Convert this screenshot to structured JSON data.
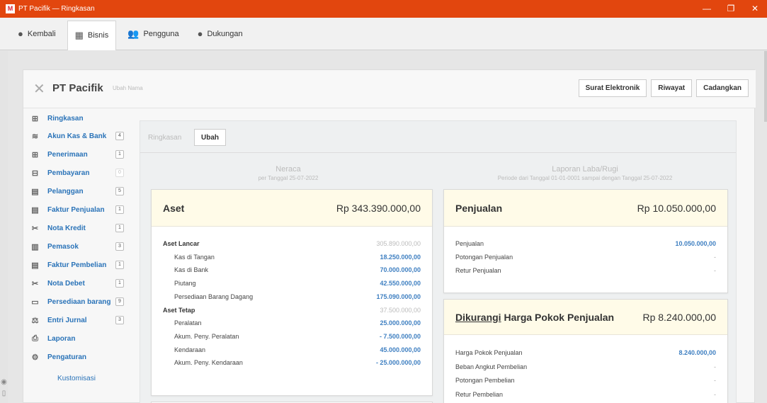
{
  "window": {
    "logo": "M",
    "title": "PT Pacifik — Ringkasan",
    "controls": [
      "—",
      "❐",
      "✕"
    ]
  },
  "topnav": [
    {
      "icon": "back-icon",
      "glyph": "●",
      "label": "Kembali"
    },
    {
      "icon": "building-icon",
      "glyph": "▦",
      "label": "Bisnis"
    },
    {
      "icon": "users-icon",
      "glyph": "👥",
      "label": "Pengguna"
    },
    {
      "icon": "help-icon",
      "glyph": "●",
      "label": "Dukungan"
    }
  ],
  "header": {
    "company": "PT Pacifik",
    "rename": "Ubah Nama",
    "buttons": [
      "Surat Elektronik",
      "Riwayat",
      "Cadangkan"
    ]
  },
  "sidebar": {
    "items": [
      {
        "label": "Ringkasan",
        "icon": "presentation-icon",
        "glyph": "⊞",
        "badge": ""
      },
      {
        "label": "Akun Kas & Bank",
        "icon": "coins-icon",
        "glyph": "≋",
        "badge": "4"
      },
      {
        "label": "Penerimaan",
        "icon": "plus-icon",
        "glyph": "⊞",
        "badge": "1"
      },
      {
        "label": "Pembayaran",
        "icon": "minus-icon",
        "glyph": "⊟",
        "badge": "0"
      },
      {
        "label": "Pelanggan",
        "icon": "customers-icon",
        "glyph": "▤",
        "badge": "5"
      },
      {
        "label": "Faktur Penjualan",
        "icon": "invoice-icon",
        "glyph": "▤",
        "badge": "1"
      },
      {
        "label": "Nota Kredit",
        "icon": "scissors-icon",
        "glyph": "✂",
        "badge": "1"
      },
      {
        "label": "Pemasok",
        "icon": "suppliers-icon",
        "glyph": "▥",
        "badge": "3"
      },
      {
        "label": "Faktur Pembelian",
        "icon": "invoice-icon",
        "glyph": "▤",
        "badge": "1"
      },
      {
        "label": "Nota Debet",
        "icon": "scissors-icon",
        "glyph": "✂",
        "badge": "1"
      },
      {
        "label": "Persediaan barang",
        "icon": "inventory-icon",
        "glyph": "▭",
        "badge": "9"
      },
      {
        "label": "Entri Jurnal",
        "icon": "journal-icon",
        "glyph": "⚖",
        "badge": "3"
      },
      {
        "label": "Laporan",
        "icon": "printer-icon",
        "glyph": "⎙",
        "badge": ""
      },
      {
        "label": "Pengaturan",
        "icon": "gear-icon",
        "glyph": "⚙",
        "badge": ""
      }
    ],
    "customize": "Kustomisasi"
  },
  "tabs": {
    "label": "Ringkasan",
    "button": "Ubah"
  },
  "neraca": {
    "title": "Neraca",
    "subtitle": "per Tanggal 25-07-2022"
  },
  "labarugi": {
    "title": "Laporan Laba/Rugi",
    "subtitle": "Periode dari Tanggal 01-01-0001 sampai dengan Tanggal 25-07-2022"
  },
  "aset": {
    "title": "Aset",
    "total": "Rp 343.390.000,00",
    "rows": [
      {
        "label": "Aset Lancar",
        "value": "305.890.000,00",
        "kind": "group"
      },
      {
        "label": "Kas di Tangan",
        "value": "18.250.000,00",
        "kind": "sub"
      },
      {
        "label": "Kas di Bank",
        "value": "70.000.000,00",
        "kind": "sub"
      },
      {
        "label": "Piutang",
        "value": "42.550.000,00",
        "kind": "sub"
      },
      {
        "label": "Persediaan Barang Dagang",
        "value": "175.090.000,00",
        "kind": "sub"
      },
      {
        "label": "Aset Tetap",
        "value": "37.500.000,00",
        "kind": "group"
      },
      {
        "label": "Peralatan",
        "value": "25.000.000,00",
        "kind": "sub"
      },
      {
        "label": "Akum. Peny. Peralatan",
        "value": "- 7.500.000,00",
        "kind": "sub"
      },
      {
        "label": "Kendaraan",
        "value": "45.000.000,00",
        "kind": "sub"
      },
      {
        "label": "Akum. Peny. Kendaraan",
        "value": "- 25.000.000,00",
        "kind": "sub"
      }
    ]
  },
  "penjualan": {
    "title": "Penjualan",
    "total": "Rp 10.050.000,00",
    "rows": [
      {
        "label": "Penjualan",
        "value": "10.050.000,00"
      },
      {
        "label": "Potongan Penjualan",
        "value": "-"
      },
      {
        "label": "Retur Penjualan",
        "value": "-"
      }
    ]
  },
  "hpp": {
    "title_prefix": "Dikurangi",
    "title_rest": " Harga Pokok Penjualan",
    "total": "Rp 8.240.000,00",
    "rows": [
      {
        "label": "Harga Pokok Penjualan",
        "value": "8.240.000,00"
      },
      {
        "label": "Beban Angkut Pembelian",
        "value": "-"
      },
      {
        "label": "Potongan Pembelian",
        "value": "-"
      },
      {
        "label": "Retur Pembelian",
        "value": "-"
      }
    ]
  }
}
